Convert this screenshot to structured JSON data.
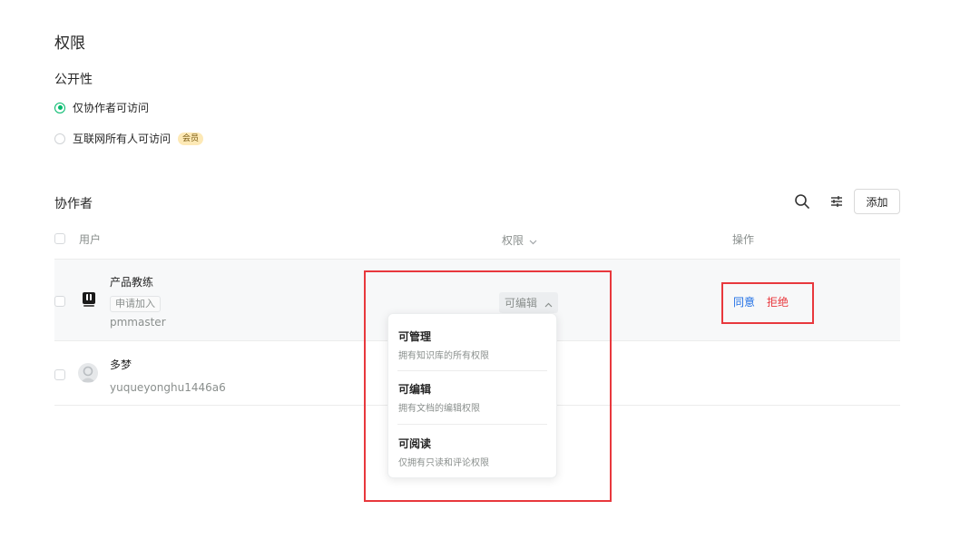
{
  "page": {
    "title": "权限",
    "visibility_heading": "公开性",
    "visibility_options": [
      {
        "label": "仅协作者可访问",
        "selected": true
      },
      {
        "label": "互联网所有人可访问",
        "selected": false,
        "badge": "会员"
      }
    ]
  },
  "collaborators": {
    "heading": "协作者",
    "add_label": "添加",
    "columns": {
      "user": "用户",
      "permission": "权限",
      "action": "操作"
    },
    "rows": [
      {
        "name": "产品教练",
        "tag": "申请加入",
        "username": "pmmaster",
        "permission": "可编辑",
        "approve": "同意",
        "reject": "拒绝"
      },
      {
        "name": "多梦",
        "username": "yuqueyonghu1446a6"
      }
    ]
  },
  "permission_menu": [
    {
      "title": "可管理",
      "desc": "拥有知识库的所有权限"
    },
    {
      "title": "可编辑",
      "desc": "拥有文档的编辑权限"
    },
    {
      "title": "可阅读",
      "desc": "仅拥有只读和评论权限"
    }
  ],
  "colors": {
    "accent": "#00b96b",
    "highlight": "#e8383d",
    "link": "#1f6fe5"
  }
}
